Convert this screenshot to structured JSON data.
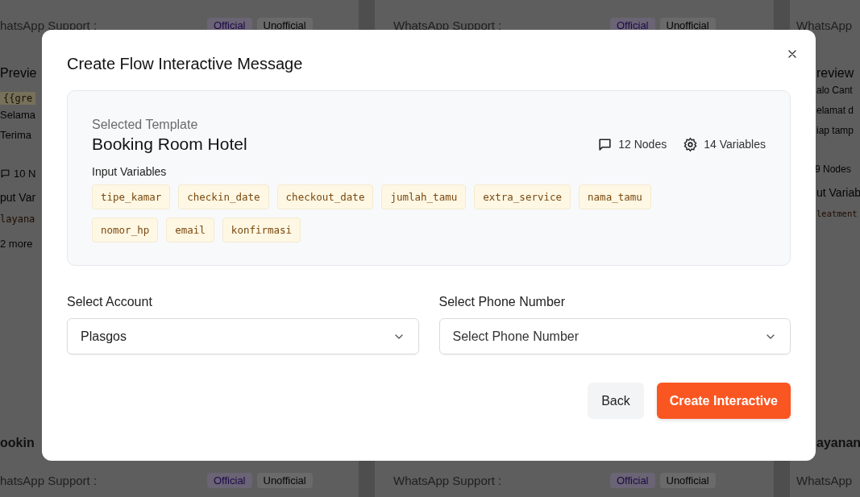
{
  "background": {
    "columns": [
      {
        "top": [
          {
            "kind": "support",
            "text": "hatsApp Support :",
            "badges": [
              {
                "label": "Official",
                "kind": "official"
              },
              {
                "label": "Unofficial",
                "kind": "unofficial"
              }
            ]
          },
          {
            "kind": "heading",
            "text": "Previe"
          },
          {
            "kind": "code",
            "text": "{{gre"
          },
          {
            "kind": "text",
            "text": "Selama"
          },
          {
            "kind": "text",
            "text": "Terima"
          },
          {
            "kind": "nodes",
            "text": "10 N"
          },
          {
            "kind": "label",
            "text": "put Var"
          },
          {
            "kind": "var",
            "text": "layana"
          },
          {
            "kind": "more",
            "text": "2 more"
          }
        ],
        "bottom": [
          {
            "kind": "title",
            "text": "ookin"
          },
          {
            "kind": "support",
            "text": "hatsApp Support :",
            "badges": [
              {
                "label": "Official",
                "kind": "official"
              },
              {
                "label": "Unofficial",
                "kind": "unofficial"
              }
            ]
          }
        ]
      },
      {
        "top": [
          {
            "kind": "support",
            "text": "WhatsApp Support :",
            "badges": [
              {
                "label": "Official",
                "kind": "official"
              },
              {
                "label": "Unofficial",
                "kind": "unofficial"
              }
            ]
          }
        ],
        "bottom": [
          {
            "kind": "support",
            "text": "WhatsApp Support :",
            "badges": [
              {
                "label": "Official",
                "kind": "official"
              },
              {
                "label": "Unofficial",
                "kind": "unofficial"
              }
            ]
          }
        ]
      },
      {
        "top": [
          {
            "kind": "support",
            "text": "WhatsApp"
          },
          {
            "kind": "heading",
            "text": "review"
          },
          {
            "kind": "text",
            "text": "alo Cant"
          },
          {
            "kind": "text",
            "text": "elamat d"
          },
          {
            "kind": "text",
            "text": "iap tamp"
          },
          {
            "kind": "nodes",
            "text": "9 Nodes"
          },
          {
            "kind": "label",
            "text": "ut Variab"
          },
          {
            "kind": "var",
            "text": "leatment"
          }
        ],
        "bottom": [
          {
            "kind": "title",
            "text": "ayanan"
          },
          {
            "kind": "support",
            "text": "WhatsApp"
          }
        ]
      }
    ]
  },
  "modal": {
    "title": "Create Flow Interactive Message",
    "template": {
      "caption": "Selected Template",
      "name": "Booking Room Hotel",
      "stats": [
        {
          "kind": "nodes",
          "text": "12 Nodes"
        },
        {
          "kind": "variables",
          "text": "14 Variables"
        }
      ],
      "variables_label": "Input Variables",
      "variables": [
        "tipe_kamar",
        "checkin_date",
        "checkout_date",
        "jumlah_tamu",
        "extra_service",
        "nama_tamu",
        "nomor_hp",
        "email",
        "konfirmasi"
      ]
    },
    "fields": [
      {
        "label": "Select Account",
        "value": "Plasgos"
      },
      {
        "label": "Select Phone Number",
        "placeholder": "Select Phone Number"
      }
    ],
    "buttons": [
      {
        "label": "Back",
        "kind": "secondary"
      },
      {
        "label": "Create Interactive",
        "kind": "primary"
      }
    ]
  }
}
